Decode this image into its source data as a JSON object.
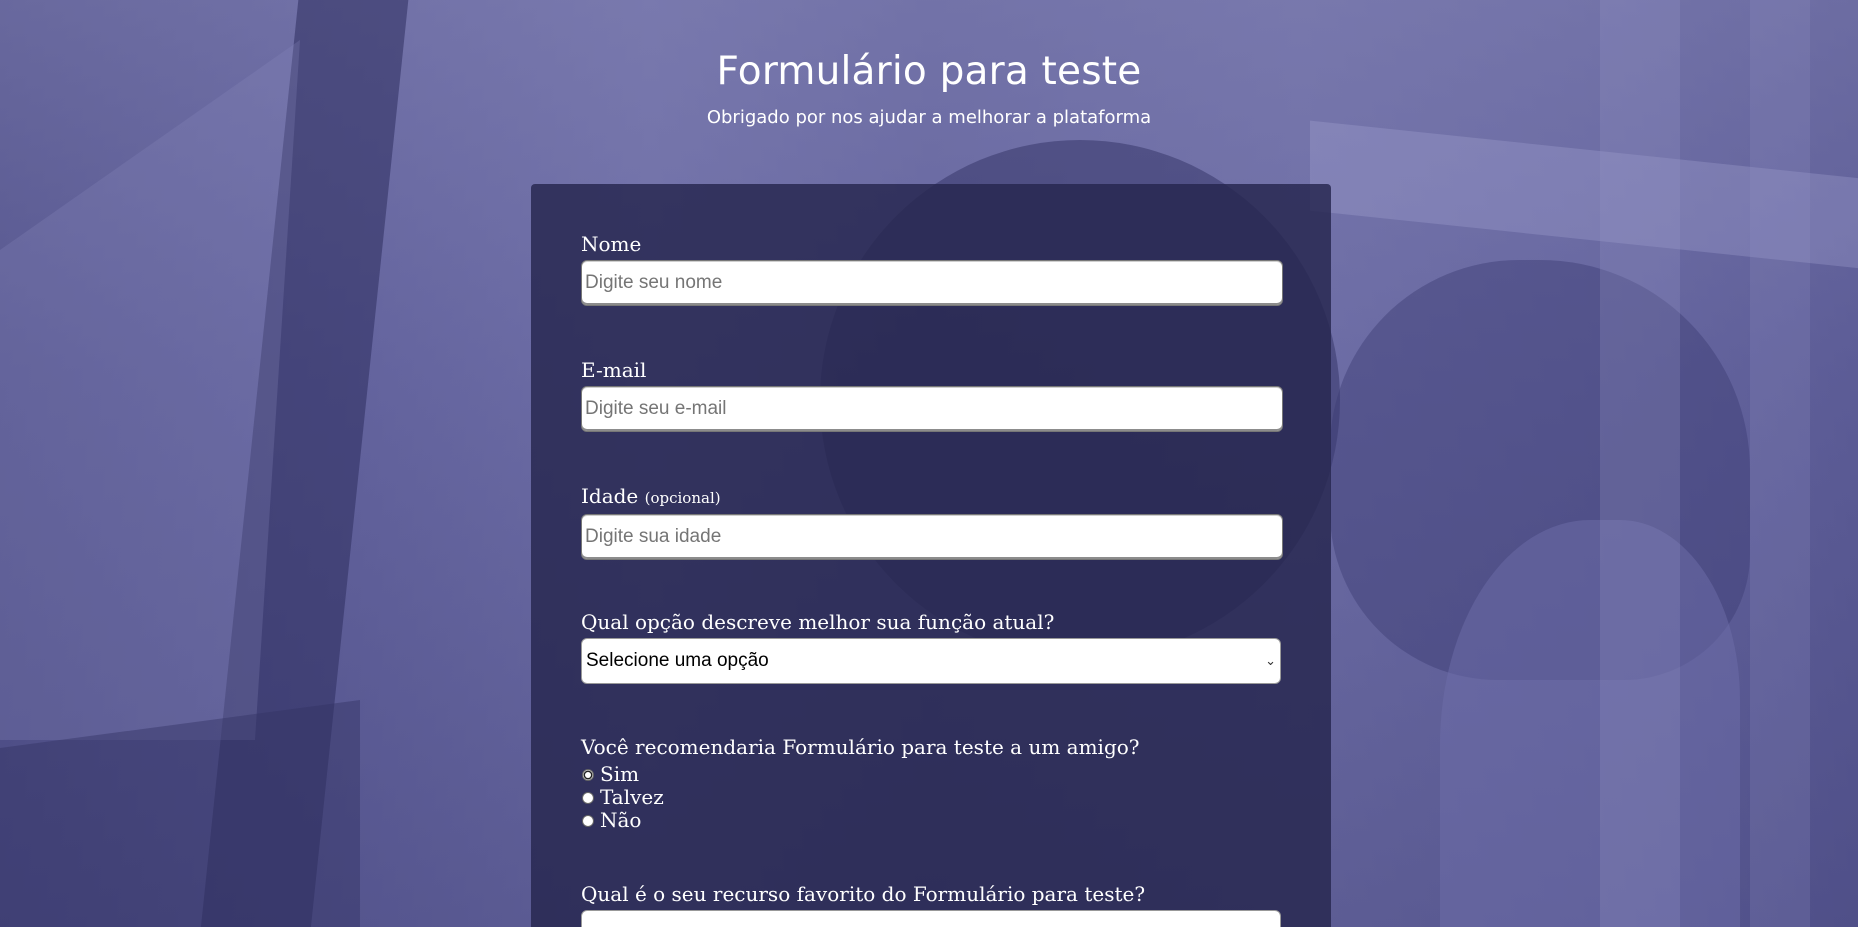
{
  "header": {
    "title": "Formulário para teste",
    "subtitle": "Obrigado por nos ajudar a melhorar a plataforma"
  },
  "form": {
    "name": {
      "label": "Nome",
      "placeholder": "Digite seu nome",
      "value": ""
    },
    "email": {
      "label": "E-mail",
      "placeholder": "Digite seu e-mail",
      "value": ""
    },
    "age": {
      "label": "Idade",
      "optional_label": "(opcional)",
      "placeholder": "Digite sua idade",
      "value": ""
    },
    "role": {
      "label": "Qual opção descreve melhor sua função atual?",
      "selected": "Selecione uma opção"
    },
    "recommend": {
      "label": "Você recomendaria Formulário para teste a um amigo?",
      "options": [
        "Sim",
        "Talvez",
        "Não"
      ],
      "selected_index": 0
    },
    "favorite_feature": {
      "label": "Qual é o seu recurso favorito do Formulário para teste?"
    }
  },
  "colors": {
    "background": "#6b6ba3",
    "card": "#26264e",
    "text": "#ffffff"
  },
  "icons": {
    "select_chevron": "chevron-down-icon"
  }
}
